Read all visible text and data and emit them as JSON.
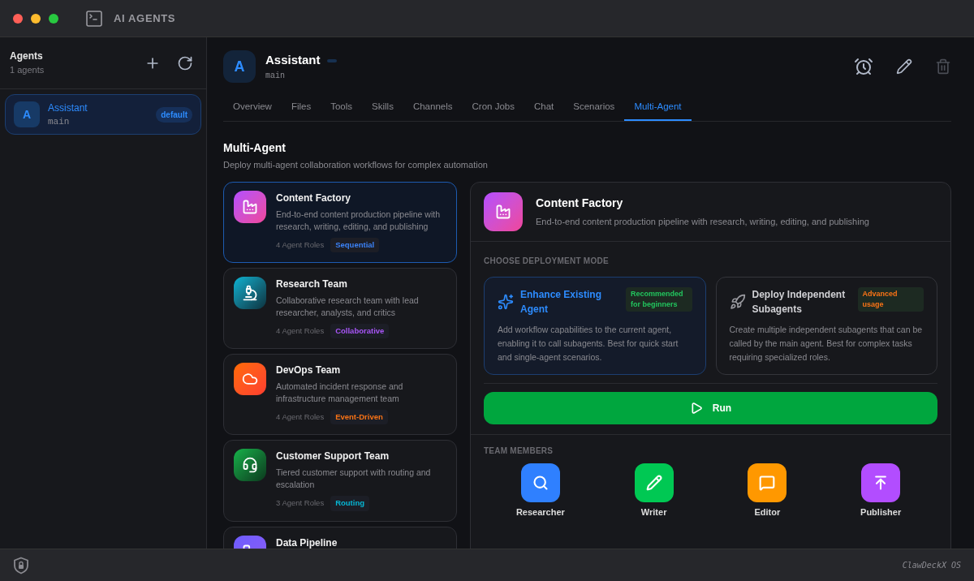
{
  "window": {
    "title": "AI AGENTS"
  },
  "sidebar": {
    "title": "Agents",
    "count": "1 agents",
    "agents": [
      {
        "initial": "A",
        "name": "Assistant",
        "id": "main",
        "badge": "default",
        "selected": true
      }
    ]
  },
  "agent": {
    "initial": "A",
    "name": "Assistant",
    "id": "main"
  },
  "tabs": [
    {
      "label": "Overview",
      "selected": false
    },
    {
      "label": "Files",
      "selected": false
    },
    {
      "label": "Tools",
      "selected": false
    },
    {
      "label": "Skills",
      "selected": false
    },
    {
      "label": "Channels",
      "selected": false
    },
    {
      "label": "Cron Jobs",
      "selected": false
    },
    {
      "label": "Chat",
      "selected": false
    },
    {
      "label": "Scenarios",
      "selected": false
    },
    {
      "label": "Multi-Agent",
      "selected": true
    }
  ],
  "section": {
    "title": "Multi-Agent",
    "subtitle": "Deploy multi-agent collaboration workflows for complex automation"
  },
  "templates": [
    {
      "kind": "factory",
      "title": "Content Factory",
      "description": "End-to-end content production pipeline with research, writing, editing, and publishing",
      "roles": "4 Agent Roles",
      "tag": "Sequential",
      "color": "#3b82f6",
      "selected": true
    },
    {
      "kind": "microscope",
      "title": "Research Team",
      "description": "Collaborative research team with lead researcher, analysts, and critics",
      "roles": "4 Agent Roles",
      "tag": "Collaborative",
      "color": "#a855f7",
      "selected": false
    },
    {
      "kind": "cloud",
      "title": "DevOps Team",
      "description": "Automated incident response and infrastructure management team",
      "roles": "4 Agent Roles",
      "tag": "Event-Driven",
      "color": "#f97316",
      "selected": false
    },
    {
      "kind": "headset",
      "title": "Customer Support Team",
      "description": "Tiered customer support with routing and escalation",
      "roles": "3 Agent Roles",
      "tag": "Routing",
      "color": "#06b6d4",
      "selected": false
    },
    {
      "kind": "pipeline",
      "title": "Data Pipeline",
      "selected": false
    }
  ],
  "detail": {
    "kind": "factory",
    "title": "Content Factory",
    "description": "End-to-end content production pipeline with research, writing, editing, and publishing",
    "mode_label": "CHOOSE DEPLOYMENT MODE",
    "modes": [
      {
        "kind": "sparkles",
        "title": "Enhance Existing Agent",
        "badge": "Recommended for beginners",
        "color": "#22c55e",
        "description": "Add workflow capabilities to the current agent, enabling it to call subagents. Best for quick start and single-agent scenarios.",
        "selected": true
      },
      {
        "kind": "rocket",
        "title": "Deploy Independent Subagents",
        "badge": "Advanced usage",
        "color": "#f97316",
        "description": "Create multiple independent subagents that can be called by the main agent. Best for complex tasks requiring specialized roles.",
        "selected": false
      }
    ],
    "run_label": "Run",
    "members_label": "TEAM MEMBERS",
    "members": [
      {
        "kind": "search",
        "name": "Researcher",
        "color": "#2f80ff"
      },
      {
        "kind": "pencil",
        "name": "Writer",
        "color": "#00c853"
      },
      {
        "kind": "message",
        "name": "Editor",
        "color": "#ff9800"
      },
      {
        "kind": "upload",
        "name": "Publisher",
        "color": "#b24dff"
      }
    ]
  },
  "status_bar": {
    "brand": "ClawDeckX OS"
  }
}
